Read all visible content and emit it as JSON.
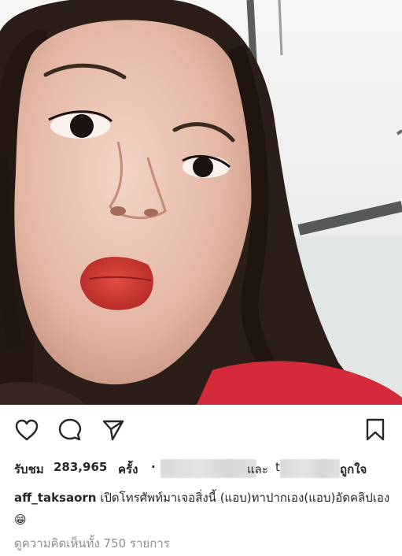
{
  "post": {
    "image_alt": "selfie of a young girl making a kissing face",
    "actions": {
      "like_icon": "heart-icon",
      "comment_icon": "comment-icon",
      "share_icon": "send-icon",
      "save_icon": "bookmark-icon"
    },
    "views": {
      "prefix": "รับชม",
      "count": "283,965",
      "unit": "ครั้ง",
      "separator": "·",
      "conjunction": "และ",
      "trailing_fragment": "t",
      "suffix": "ถูกใจ"
    },
    "caption": {
      "username": "aff_taksaorn",
      "text": "เปิดโทรศัพท์มาเจอสิ่งนี้ (แอบ)ทาปากเอง(แอบ)อัดคลิปเอง",
      "emoji": "😁"
    },
    "comments_link": "ดูความคิดเห็นทั้ง 750 รายการ"
  },
  "colors": {
    "text": "#262626",
    "muted": "#8e8e8e",
    "background": "#ffffff"
  }
}
